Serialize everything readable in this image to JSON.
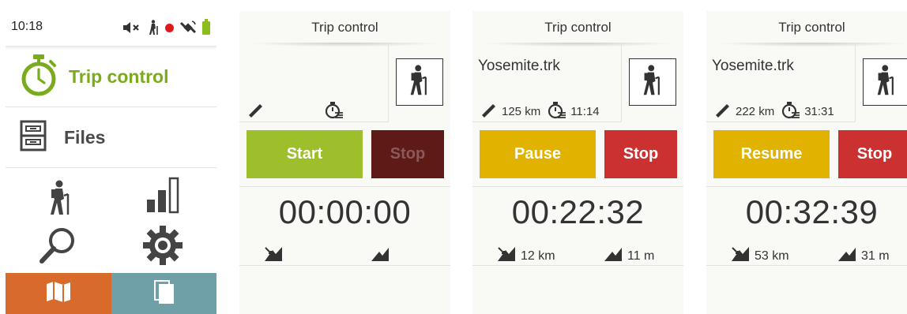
{
  "status_bar": {
    "time": "10:18",
    "icons": [
      "mute-icon",
      "hiker-icon",
      "recording-dot-icon",
      "satellite-icon",
      "battery-icon"
    ],
    "recording_color": "#e01919",
    "battery_color": "#8bbe1c"
  },
  "main_menu": {
    "items": [
      {
        "label": "Trip control",
        "icon": "stopwatch-icon",
        "color": "#7aab1e"
      },
      {
        "label": "Files",
        "icon": "file-cabinet-icon"
      }
    ],
    "grid_icons": [
      "hiker-icon",
      "signal-bars-icon",
      "search-icon",
      "gear-icon"
    ],
    "bottom_tabs": [
      {
        "icon": "map-icon",
        "color": "#d86b2c"
      },
      {
        "icon": "pages-icon",
        "color": "#6fa0a8"
      }
    ]
  },
  "trip_screens": [
    {
      "header": "Trip control",
      "file": "",
      "distance": "",
      "duration": "",
      "primary_button": "Start",
      "stop_button": "Stop",
      "timer": "00:00:00",
      "descent": "",
      "ascent": "",
      "state": "stopped"
    },
    {
      "header": "Trip control",
      "file": "Yosemite.trk",
      "distance": "125 km",
      "duration": "11:14",
      "primary_button": "Pause",
      "stop_button": "Stop",
      "timer": "00:22:32",
      "descent": "12 km",
      "ascent": "11 m",
      "state": "recording"
    },
    {
      "header": "Trip control",
      "file": "Yosemite.trk",
      "distance": "222 km",
      "duration": "31:31",
      "primary_button": "Resume",
      "stop_button": "Stop",
      "timer": "00:32:39",
      "descent": "53 km",
      "ascent": "31 m",
      "state": "paused"
    }
  ],
  "colors": {
    "start": "#9dbf2c",
    "stop_disabled": "#5e1a17",
    "pause_resume": "#e1b200",
    "stop": "#cb3130"
  }
}
